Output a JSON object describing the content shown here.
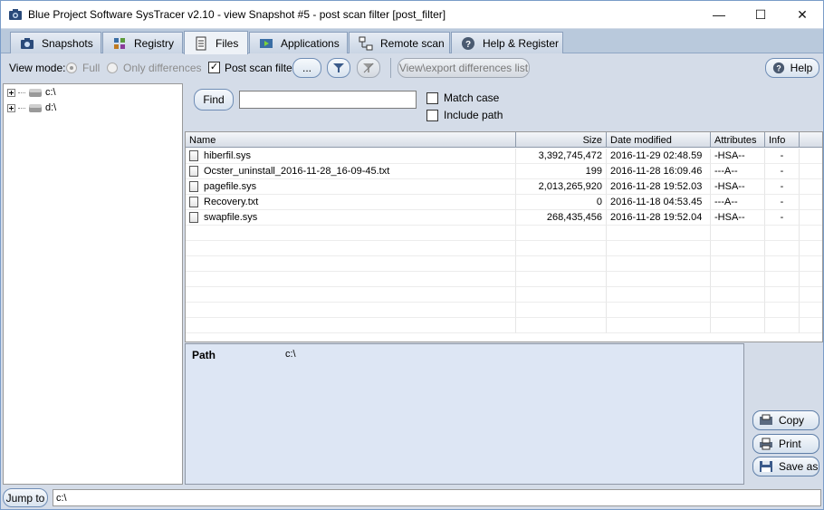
{
  "window": {
    "title": "Blue Project Software SysTracer v2.10 - view Snapshot #5 - post scan filter [post_filter]",
    "minimize": "—",
    "maximize": "☐",
    "close": "✕"
  },
  "tabs": [
    {
      "label": "Snapshots",
      "icon": "camera-icon"
    },
    {
      "label": "Registry",
      "icon": "registry-icon"
    },
    {
      "label": "Files",
      "icon": "files-icon",
      "active": true
    },
    {
      "label": "Applications",
      "icon": "applications-icon"
    },
    {
      "label": "Remote scan",
      "icon": "network-icon"
    },
    {
      "label": "Help & Register",
      "icon": "help-icon"
    }
  ],
  "toolbar": {
    "view_mode_label": "View mode:",
    "full_label": "Full",
    "only_diff_label": "Only differences",
    "post_scan_filter_label": "Post scan filter",
    "dots_label": "...",
    "view_export_label": "View\\export differences list",
    "help_label": "Help"
  },
  "tree": {
    "items": [
      {
        "label": "c:\\"
      },
      {
        "label": "d:\\"
      }
    ]
  },
  "search": {
    "find_label": "Find",
    "query": "",
    "match_case_label": "Match case",
    "include_path_label": "Include path"
  },
  "table": {
    "columns": [
      "Name",
      "Size",
      "Date modified",
      "Attributes",
      "Info"
    ],
    "rows": [
      {
        "name": "hiberfil.sys",
        "size": "3,392,745,472",
        "date": "2016-11-29 02:48.59",
        "attr": "-HSA--",
        "info": "-"
      },
      {
        "name": "Ocster_uninstall_2016-11-28_16-09-45.txt",
        "size": "199",
        "date": "2016-11-28 16:09.46",
        "attr": "---A--",
        "info": "-"
      },
      {
        "name": "pagefile.sys",
        "size": "2,013,265,920",
        "date": "2016-11-28 19:52.03",
        "attr": "-HSA--",
        "info": "-"
      },
      {
        "name": "Recovery.txt",
        "size": "0",
        "date": "2016-11-18 04:53.45",
        "attr": "---A--",
        "info": "-"
      },
      {
        "name": "swapfile.sys",
        "size": "268,435,456",
        "date": "2016-11-28 19:52.04",
        "attr": "-HSA--",
        "info": "-"
      }
    ]
  },
  "details": {
    "path_label": "Path",
    "path_value": "c:\\"
  },
  "side_buttons": {
    "copy_label": "Copy",
    "print_label": "Print",
    "save_as_label": "Save as"
  },
  "bottom": {
    "jump_label": "Jump to",
    "jump_value": "c:\\"
  }
}
